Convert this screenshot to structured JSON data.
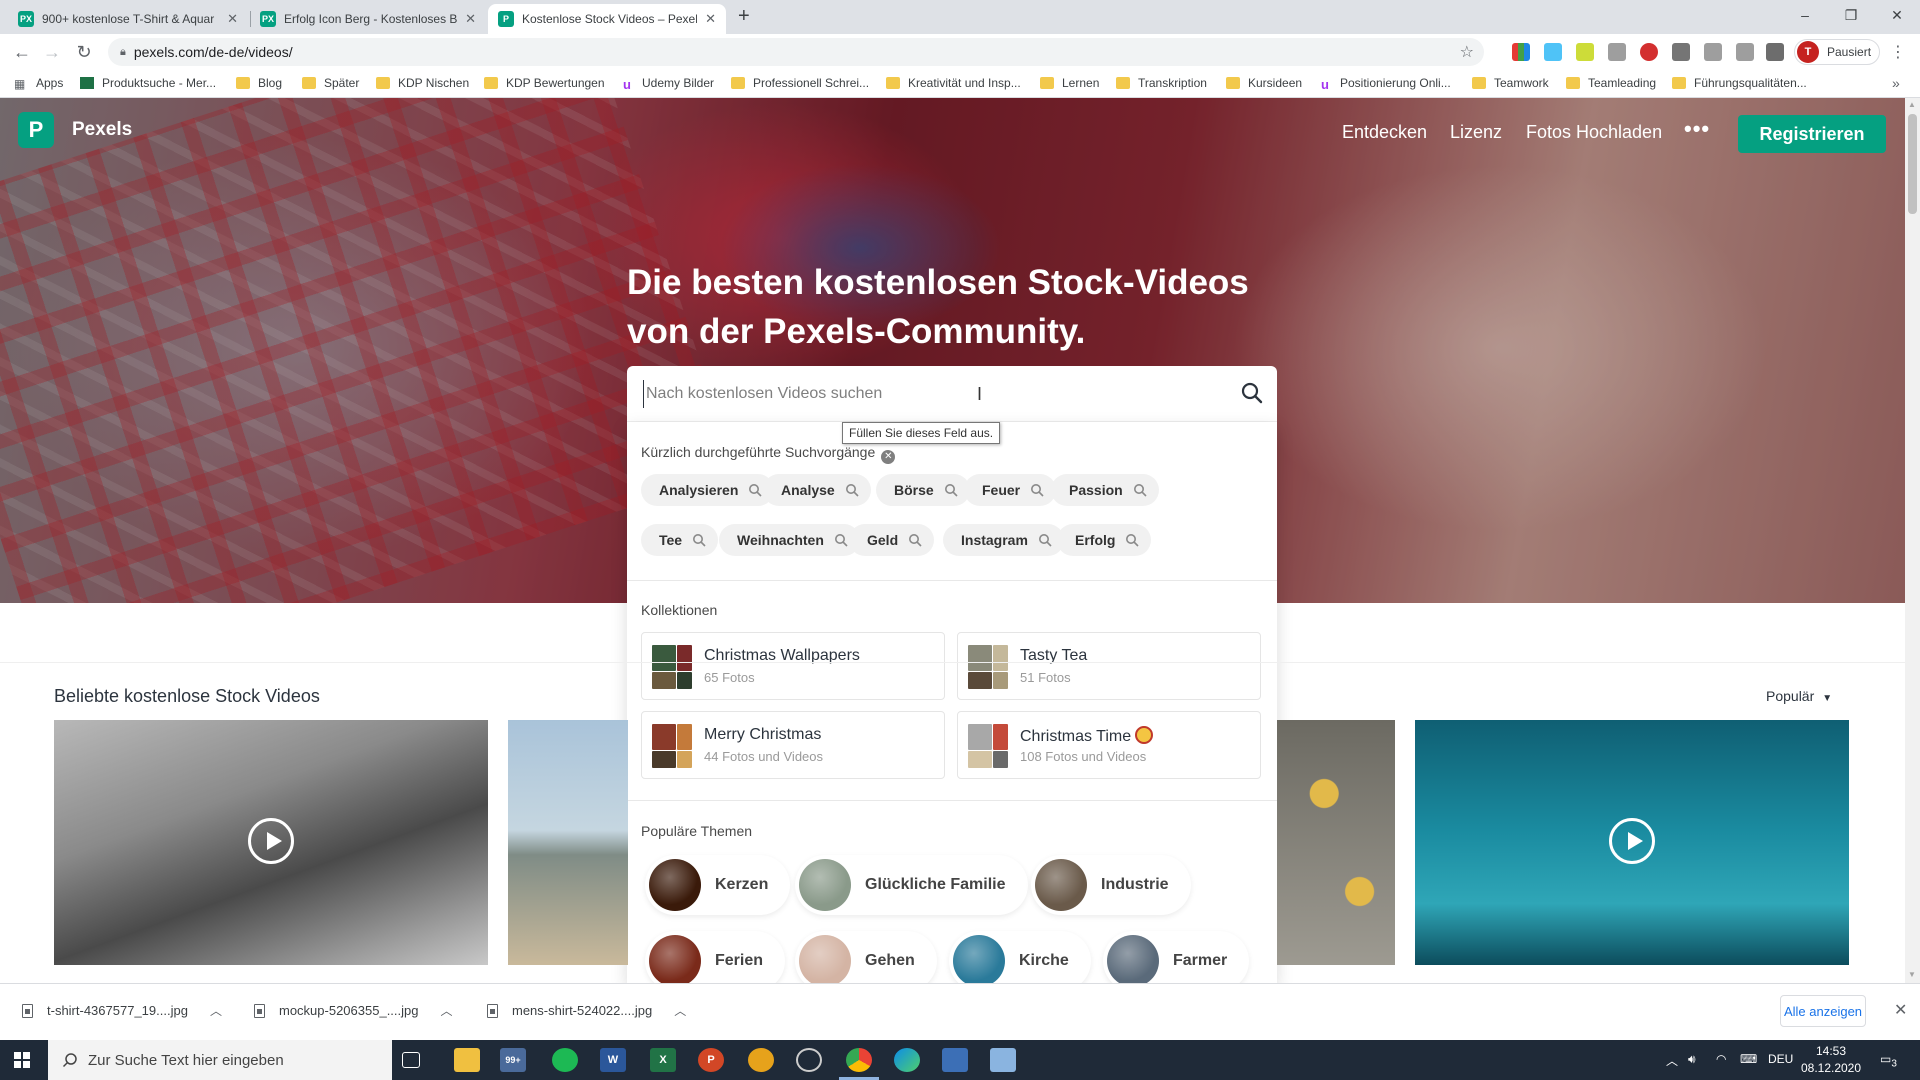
{
  "browser": {
    "tabs": [
      {
        "title": "900+ kostenlose T-Shirt & Aquar",
        "favicon_color": "#05a081",
        "favicon_text": "PX"
      },
      {
        "title": "Erfolg Icon Berg - Kostenloses Bi",
        "favicon_color": "#05a081",
        "favicon_text": "PX"
      },
      {
        "title": "Kostenlose Stock Videos – Pexels",
        "favicon_color": "#05a081",
        "favicon_text": "P"
      }
    ],
    "url": "pexels.com/de-de/videos/",
    "profile_label": "Pausiert",
    "profile_initial": "T",
    "bookmarks": [
      {
        "label": "Apps",
        "icon": "grid-icon"
      },
      {
        "label": "Produktsuche - Mer...",
        "icon": "app-icon"
      },
      {
        "label": "Blog",
        "icon": "folder-icon"
      },
      {
        "label": "Später",
        "icon": "folder-icon"
      },
      {
        "label": "KDP Nischen",
        "icon": "folder-icon"
      },
      {
        "label": "KDP Bewertungen",
        "icon": "folder-icon"
      },
      {
        "label": "Udemy Bilder",
        "icon": "udemy-icon"
      },
      {
        "label": "Professionell Schrei...",
        "icon": "folder-icon"
      },
      {
        "label": "Kreativität und Insp...",
        "icon": "folder-icon"
      },
      {
        "label": "Lernen",
        "icon": "folder-icon"
      },
      {
        "label": "Transkription",
        "icon": "folder-icon"
      },
      {
        "label": "Kursideen",
        "icon": "folder-icon"
      },
      {
        "label": "Positionierung Onli...",
        "icon": "udemy-icon"
      },
      {
        "label": "Teamwork",
        "icon": "folder-icon"
      },
      {
        "label": "Teamleading",
        "icon": "folder-icon"
      },
      {
        "label": "Führungsqualitäten...",
        "icon": "folder-icon"
      }
    ]
  },
  "site": {
    "brand": "Pexels",
    "brand_color": "#05a081",
    "nav": {
      "discover": "Entdecken",
      "license": "Lizenz",
      "upload": "Fotos Hochladen",
      "more": "•••",
      "register": "Registrieren"
    },
    "hero": {
      "title_line1": "Die besten kostenlosen Stock-Videos",
      "title_line2": "von der Pexels-Community."
    },
    "search": {
      "placeholder": "Nach kostenlosen Videos suchen",
      "value": "",
      "tooltip": "Füllen Sie dieses Feld aus."
    },
    "dropdown": {
      "recent_label": "Kürzlich durchgeführte Suchvorgänge",
      "recent": [
        "Analysieren",
        "Analyse",
        "Börse",
        "Feuer",
        "Passion",
        "Tee",
        "Weihnachten",
        "Geld",
        "Instagram",
        "Erfolg"
      ],
      "collections_label": "Kollektionen",
      "collections": [
        {
          "title": "Christmas Wallpapers",
          "sub": "65 Fotos",
          "colors": [
            "#3a5a3e",
            "#7a2a2a",
            "#6b5a3e",
            "#2e3e2e"
          ]
        },
        {
          "title": "Tasty Tea",
          "sub": "51 Fotos",
          "colors": [
            "#8a8a7a",
            "#c4b89a",
            "#5a4a3a",
            "#a89a7a"
          ]
        },
        {
          "title": "Merry Christmas",
          "sub": "44 Fotos und Videos",
          "colors": [
            "#8a3a2a",
            "#c47a3a",
            "#4a3a2a",
            "#d4a45a"
          ]
        },
        {
          "title": "Christmas Time",
          "sub": "108 Fotos und Videos",
          "colors": [
            "#a8a8a8",
            "#c44a3a",
            "#d4c4a4",
            "#6a6a6a"
          ]
        }
      ],
      "topics_label": "Populäre Themen",
      "topics": [
        {
          "label": "Kerzen",
          "color": "#3a1a0a"
        },
        {
          "label": "Glückliche Familie",
          "color": "#8a9a8a"
        },
        {
          "label": "Industrie",
          "color": "#6a5a4a"
        },
        {
          "label": "Ferien",
          "color": "#7a2a1a"
        },
        {
          "label": "Gehen",
          "color": "#d4b4a4"
        },
        {
          "label": "Kirche",
          "color": "#2a7a9a"
        },
        {
          "label": "Farmer",
          "color": "#5a6a7a"
        }
      ]
    },
    "popular": {
      "title": "Beliebte kostenlose Stock Videos",
      "sort_label": "Populär"
    }
  },
  "downloads": {
    "items": [
      "t-shirt-4367577_19....jpg",
      "mockup-5206355_....jpg",
      "mens-shirt-524022....jpg"
    ],
    "show_all": "Alle anzeigen"
  },
  "taskbar": {
    "search_placeholder": "Zur Suche Text hier eingeben",
    "mail_badge": "99+",
    "language": "DEU",
    "time": "14:53",
    "date": "08.12.2020",
    "notification_count": "3"
  }
}
